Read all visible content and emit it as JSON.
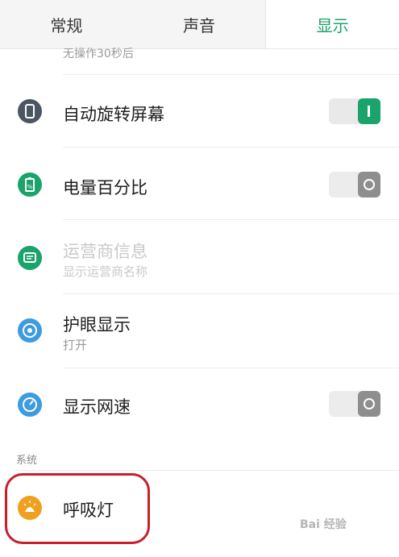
{
  "tabs": [
    "常规",
    "声音",
    "显示"
  ],
  "active_tab": "显示",
  "partial_text": "无操作30秒后",
  "items": [
    {
      "title": "自动旋转屏幕",
      "icon": "screen-rotate-icon",
      "color": "#4b5563",
      "toggle": "on"
    },
    {
      "title": "电量百分比",
      "icon": "battery-percent-icon",
      "color": "#1aa36a",
      "toggle": "off"
    },
    {
      "title": "运营商信息",
      "subtitle": "显示运营商名称",
      "icon": "carrier-info-icon",
      "color": "#1aa36a",
      "disabled": true
    },
    {
      "title": "护眼显示",
      "subtitle": "打开",
      "icon": "eye-protection-icon",
      "color": "#3d9be0"
    },
    {
      "title": "显示网速",
      "icon": "network-speed-icon",
      "color": "#3d9be0",
      "toggle": "off"
    },
    {
      "title": "呼吸灯",
      "icon": "breathing-light-icon",
      "color": "#f0a020"
    }
  ],
  "section_system": "系统",
  "watermark": "Bai 经验"
}
